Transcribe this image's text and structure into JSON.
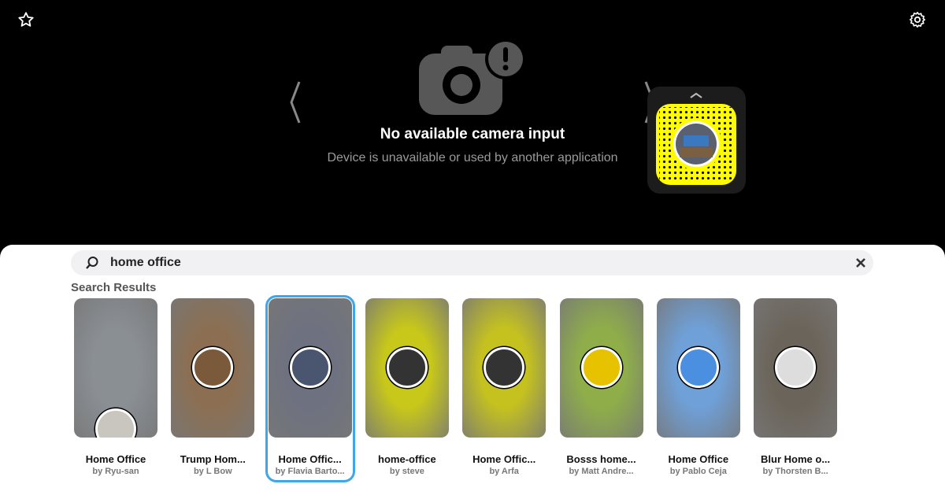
{
  "header": {
    "favorite_icon": "star-icon",
    "settings_icon": "gear-icon"
  },
  "camera": {
    "icon": "camera-error-icon",
    "title": "No available camera input",
    "subtitle": "Device is unavailable or used by another application"
  },
  "snapcode": {
    "color": "#fffc00"
  },
  "search": {
    "value": "home office",
    "icon": "search-icon",
    "clear_icon": "close-icon"
  },
  "results_label": "Search Results",
  "selected_color": "#3ea6ea",
  "results": [
    {
      "title": "Home Office",
      "author": "by Ryu-san",
      "bg": "#8a8f94",
      "icon_bg": "#c9c6c0"
    },
    {
      "title": "Trump Hom...",
      "author": "by L Bow",
      "bg": "#8c6f52",
      "icon_bg": "#7a5a3a"
    },
    {
      "title": "Home Offic...",
      "author": "by Flavia Barto...",
      "bg": "#6e7280",
      "icon_bg": "#4a5670",
      "selected": true
    },
    {
      "title": "home-office",
      "author": "by steve",
      "bg": "#c8c81a",
      "icon_bg": "#333"
    },
    {
      "title": "Home Offic...",
      "author": "by Arfa",
      "bg": "#c5c21f",
      "icon_bg": "#333"
    },
    {
      "title": "Bosss home...",
      "author": "by Matt Andre...",
      "bg": "#8fae4a",
      "icon_bg": "#e6c200"
    },
    {
      "title": "Home Office",
      "author": "by Pablo Ceja",
      "bg": "#6fa0d8",
      "icon_bg": "#4a8fe0"
    },
    {
      "title": "Blur Home o...",
      "author": "by Thorsten B...",
      "bg": "#6b645a",
      "icon_bg": "#ddd"
    }
  ]
}
